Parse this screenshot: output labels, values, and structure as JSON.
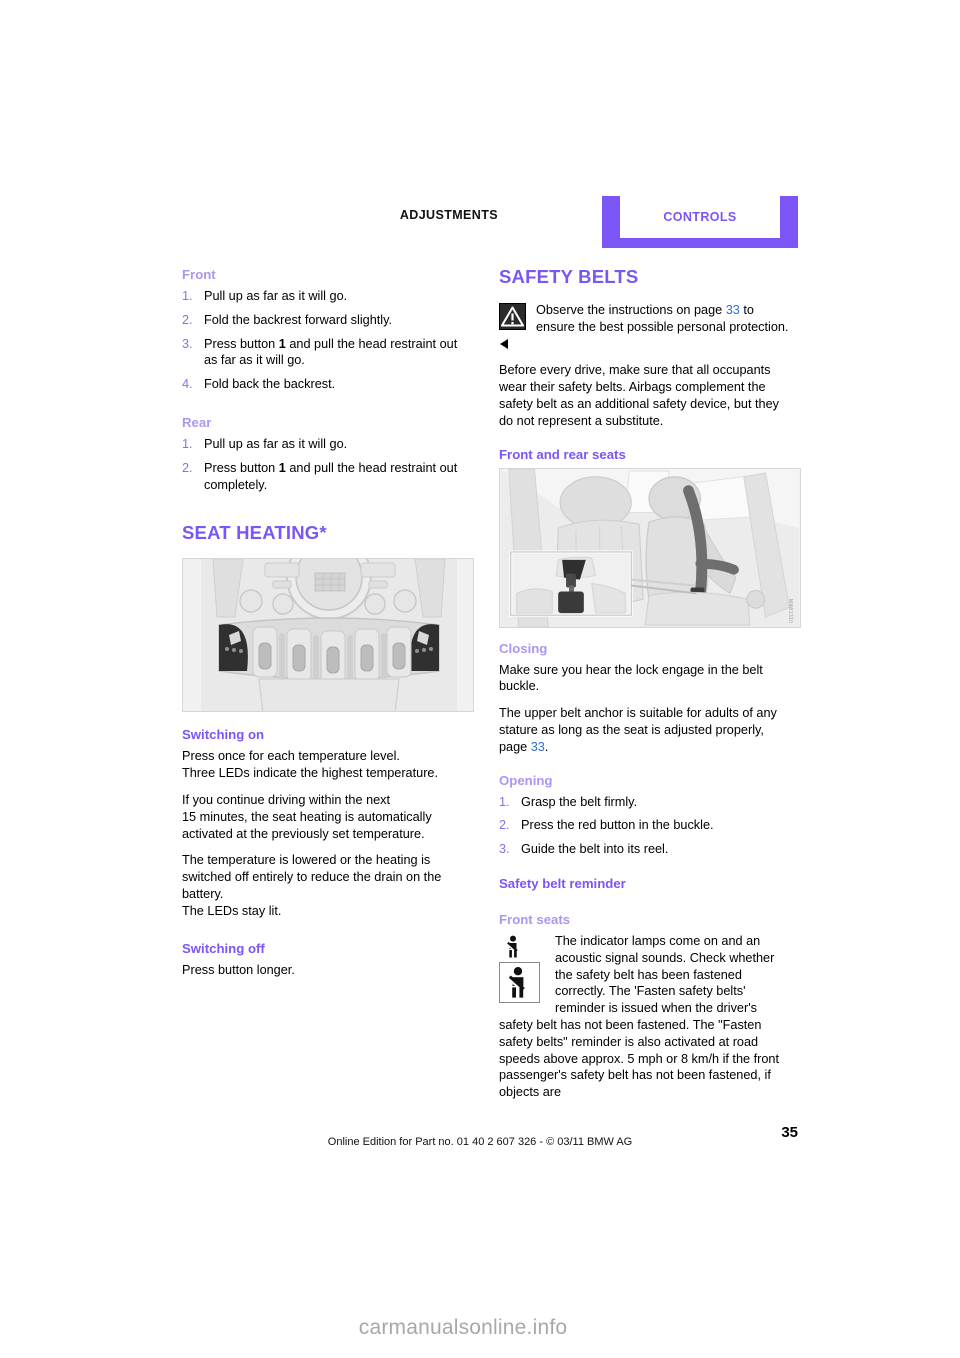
{
  "header": {
    "left_label": "ADJUSTMENTS",
    "tab_label": "CONTROLS",
    "accent_color": "#7b55f5"
  },
  "left_column": {
    "head_restraint": {
      "front_heading": "Front",
      "front_steps": [
        {
          "num": "1.",
          "text": "Pull up as far as it will go."
        },
        {
          "num": "2.",
          "text": "Fold the backrest forward slightly."
        },
        {
          "num": "3.",
          "text_before": "Press button ",
          "emph": "1",
          "text_after": " and pull the head restraint out as far as it will go."
        },
        {
          "num": "4.",
          "text": "Fold back the backrest."
        }
      ],
      "rear_heading": "Rear",
      "rear_steps": [
        {
          "num": "1.",
          "text": "Pull up as far as it will go."
        },
        {
          "num": "2.",
          "text_before": "Press button ",
          "emph": "1",
          "text_after": " and pull the head restraint out completely."
        }
      ]
    },
    "seat_heating": {
      "title": "SEAT HEATING*",
      "figure_alt": "center-console-toggle-switches",
      "switching_on_heading": "Switching on",
      "switching_on_p1": "Press once for each temperature level.\nThree LEDs indicate the highest temperature.",
      "switching_on_p2": "If you continue driving within the next\n15 minutes, the seat heating is automatically activated at the previously set temperature.",
      "switching_on_p3": "The temperature is lowered or the heating is switched off entirely to reduce the drain on the battery.\nThe LEDs stay lit.",
      "switching_off_heading": "Switching off",
      "switching_off_p1": "Press button longer."
    }
  },
  "right_column": {
    "safety_belts": {
      "title": "SAFETY BELTS",
      "warning_icon": "warning-triangle-icon",
      "warning_before": "Observe the instructions on page ",
      "warning_pageref": "33",
      "warning_after": " to ensure the best possible personal protection.",
      "intro": "Before every drive, make sure that all occupants wear their safety belts. Airbags complement the safety belt as an additional safety device, but they do not represent a substitute.",
      "front_rear_heading": "Front and rear seats",
      "figure_alt": "front-and-rear-seat-belt-photo",
      "figure_code": "MINI1310",
      "closing_heading": "Closing",
      "closing_p1": "Make sure you hear the lock engage in the belt buckle.",
      "closing_p2_before": "The upper belt anchor is suitable for adults of any stature as long as the seat is adjusted properly, page ",
      "closing_p2_pageref": "33",
      "closing_p2_after": ".",
      "opening_heading": "Opening",
      "opening_steps": [
        {
          "num": "1.",
          "text": "Grasp the belt firmly."
        },
        {
          "num": "2.",
          "text": "Press the red button in the buckle."
        },
        {
          "num": "3.",
          "text": "Guide the belt into its reel."
        }
      ],
      "reminder_heading": "Safety belt reminder",
      "front_seats_heading": "Front seats",
      "belt_icon_small": "seatbelt-person-icon",
      "belt_icon_large": "seatbelt-warning-lamp-icon",
      "reminder_text": "The indicator lamps come on and an acoustic signal sounds. Check whether the safety belt has been fastened correctly. The 'Fasten safety belts' reminder is issued when the driver's safety belt has not been fastened. The \"Fasten safety belts\" reminder is also activated at road speeds above approx. 5 mph or 8 km/h if the front passenger's safety belt has not been fastened, if objects are"
    }
  },
  "footer": {
    "text": "Online Edition for Part no. 01 40 2 607 326 - © 03/11 BMW AG",
    "page_number": "35"
  },
  "watermark": {
    "text": "carmanualsonline.info"
  }
}
